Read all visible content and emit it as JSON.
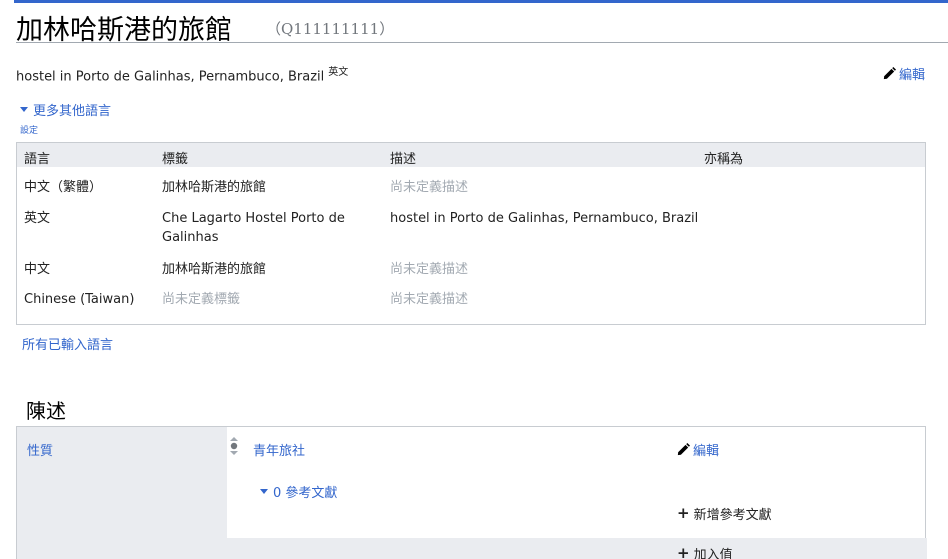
{
  "header": {
    "title": "加林哈斯港的旅館",
    "qid": "（Q111111111）"
  },
  "description": {
    "text": "hostel in Porto de Galinhas, Pernambuco, Brazil",
    "lang": "英文",
    "edit_label": "編輯"
  },
  "languages": {
    "more_label": "更多其他語言",
    "settings_label": "設定",
    "columns": [
      "語言",
      "標籤",
      "描述",
      "亦稱為"
    ],
    "rows": [
      {
        "lang": "中文（繁體）",
        "label": "加林哈斯港的旅館",
        "desc": "尚未定義描述",
        "aliases": ""
      },
      {
        "lang": "英文",
        "label": "Che Lagarto Hostel Porto de Galinhas",
        "desc": "hostel in Porto de Galinhas, Pernambuco, Brazil",
        "aliases": ""
      },
      {
        "lang": "中文",
        "label": "加林哈斯港的旅館",
        "desc": "尚未定義描述",
        "aliases": ""
      },
      {
        "lang": "Chinese (Taiwan)",
        "label": "尚未定義標籤",
        "desc": "尚未定義描述",
        "aliases": ""
      }
    ],
    "all_entered_label": "所有已輸入語言"
  },
  "statements": {
    "section_title": "陳述",
    "property": "性質",
    "value": "青年旅社",
    "edit_label": "編輯",
    "references_toggle": "0 參考文獻",
    "add_reference_label": "新增參考文獻",
    "add_value_label": "加入值"
  },
  "colors": {
    "link": "#3366cc",
    "header_bg": "#eaecf0",
    "muted": "#a2a9b1"
  }
}
